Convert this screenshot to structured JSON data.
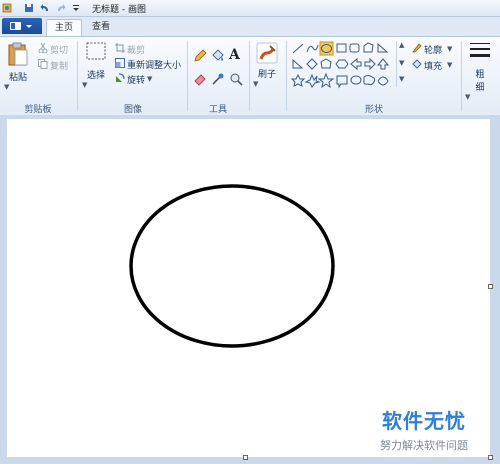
{
  "window": {
    "title": "无标题 - 画图"
  },
  "tabs": [
    {
      "label": "主页"
    },
    {
      "label": "查看"
    }
  ],
  "ribbon": {
    "clipboard": {
      "paste": "粘贴",
      "cut": "剪切",
      "copy": "复制",
      "group": "剪贴板"
    },
    "image": {
      "select": "选择",
      "crop": "裁剪",
      "resize": "重新调整大小",
      "rotate": "旋转",
      "group": "图像"
    },
    "tools": {
      "group": "工具",
      "text_glyph": "A"
    },
    "brushes": {
      "label": "刷子"
    },
    "shapes": {
      "group": "形状",
      "outline": "轮廓",
      "fill": "填充"
    },
    "size": {
      "label1": "粗",
      "label2": "细"
    }
  },
  "canvas": {
    "shape": "ellipse",
    "shape_stroke": "#000000"
  },
  "watermark": {
    "title": "软件无忧",
    "subtitle": "努力解决软件问题"
  },
  "colors": {
    "accent": "#1a4b98",
    "ribbon_bg": "#e3ecf7",
    "selected_shape": "#f5c85a",
    "watermark": "#2f7fd8"
  }
}
